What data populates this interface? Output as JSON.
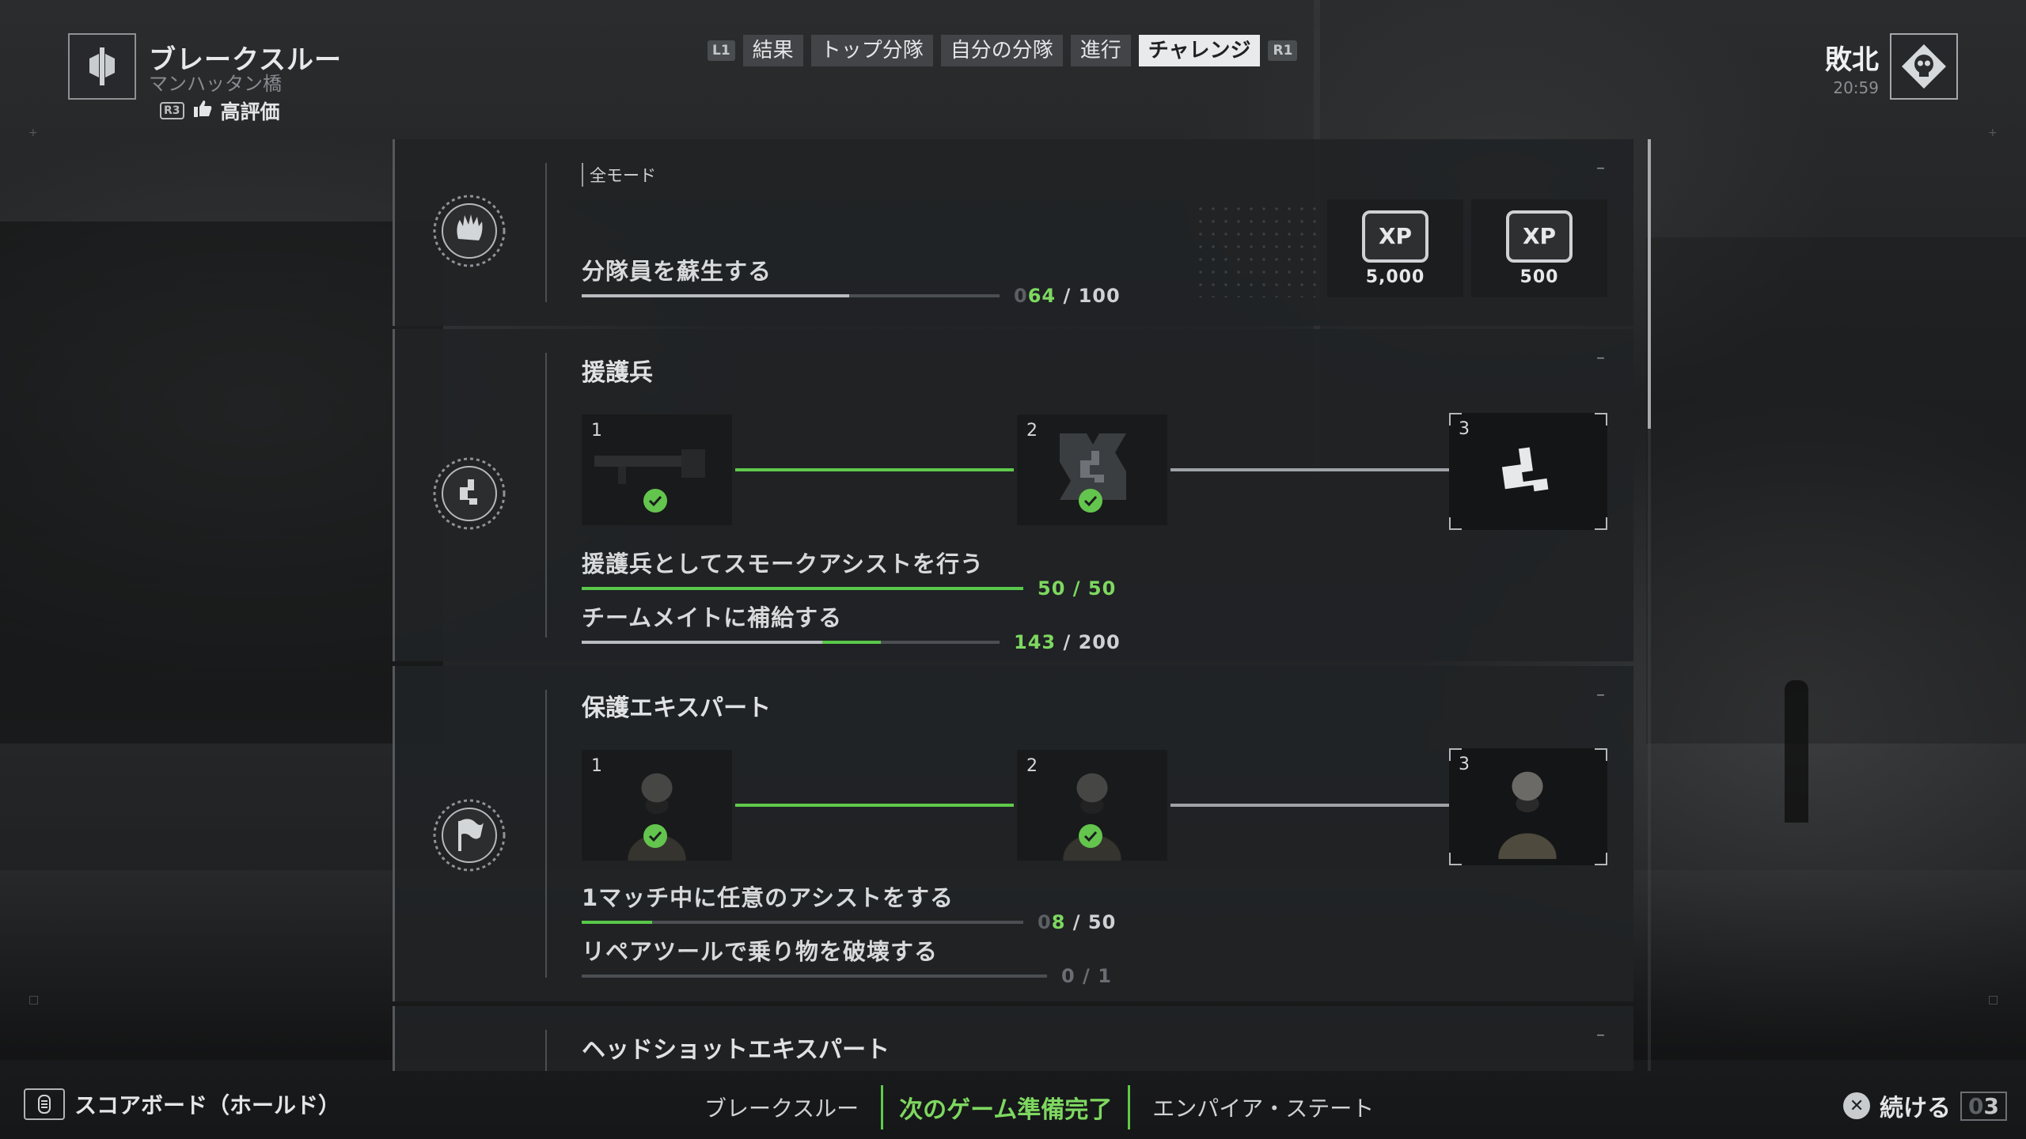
{
  "header": {
    "mode_title": "ブレークスルー",
    "map_name": "マンハッタン橋",
    "rating_button": "R3",
    "rating_label": "高評価",
    "result": "敗北",
    "match_time": "20:59"
  },
  "tabs": {
    "left_bumper": "L1",
    "right_bumper": "R1",
    "items": [
      {
        "label": "結果",
        "active": false
      },
      {
        "label": "トップ分隊",
        "active": false
      },
      {
        "label": "自分の分隊",
        "active": false
      },
      {
        "label": "進行",
        "active": false
      },
      {
        "label": "チャレンジ",
        "active": true
      }
    ]
  },
  "challenges": [
    {
      "medal_icon": "fist-laurel-icon",
      "tag": "全モード",
      "objectives": [
        {
          "name": "分隊員を蘇生する",
          "prefix": "0",
          "current": "64",
          "sep": " / ",
          "total": "100",
          "progress": 0.64
        }
      ],
      "rewards": [
        {
          "icon": "xp-chip-icon",
          "label": "XP",
          "value": "5,000"
        },
        {
          "icon": "xp-chip-icon",
          "label": "XP",
          "value": "500"
        }
      ]
    },
    {
      "medal_icon": "support-laurel-icon",
      "title": "援護兵",
      "tiers": [
        {
          "num": "1",
          "completed": true,
          "art": "weapon-image"
        },
        {
          "num": "2",
          "completed": true,
          "art": "support-emblem-icon"
        },
        {
          "num": "3",
          "completed": false,
          "art": "support-emblem-icon"
        }
      ],
      "objectives": [
        {
          "name": "援護兵としてスモークアシストを行う",
          "current": "50",
          "sep": " / ",
          "total": "50",
          "progress": 1.0
        },
        {
          "name": "チームメイトに補給する",
          "current": "143",
          "sep": " / ",
          "total": "200",
          "progress": 0.715
        }
      ]
    },
    {
      "medal_icon": "flag-laurel-icon",
      "title": "保護エキスパート",
      "tiers": [
        {
          "num": "1",
          "completed": true,
          "art": "operator-portrait"
        },
        {
          "num": "2",
          "completed": true,
          "art": "operator-portrait"
        },
        {
          "num": "3",
          "completed": false,
          "art": "operator-portrait"
        }
      ],
      "objectives": [
        {
          "name": "1マッチ中に任意のアシストをする",
          "prefix": "0",
          "current": "8",
          "sep": " / ",
          "total": "50",
          "progress": 0.16
        },
        {
          "name": "リペアツールで乗り物を破壊する",
          "current": "0",
          "sep": " / ",
          "total": "1",
          "progress": 0.0
        }
      ]
    },
    {
      "title": "ヘッドショットエキスパート"
    }
  ],
  "footer": {
    "scoreboard_label": "スコアボード（ホールド）",
    "current_mode": "ブレークスルー",
    "ready_label": "次のゲーム準備完了",
    "next_mode": "エンパイア・ステート",
    "continue_label": "続ける",
    "countdown_prefix": "0",
    "countdown": "3"
  },
  "colors": {
    "accent_green": "#5fca4b",
    "progress_text_green": "#7ed860",
    "active_tab_bg": "#e8eaec"
  }
}
